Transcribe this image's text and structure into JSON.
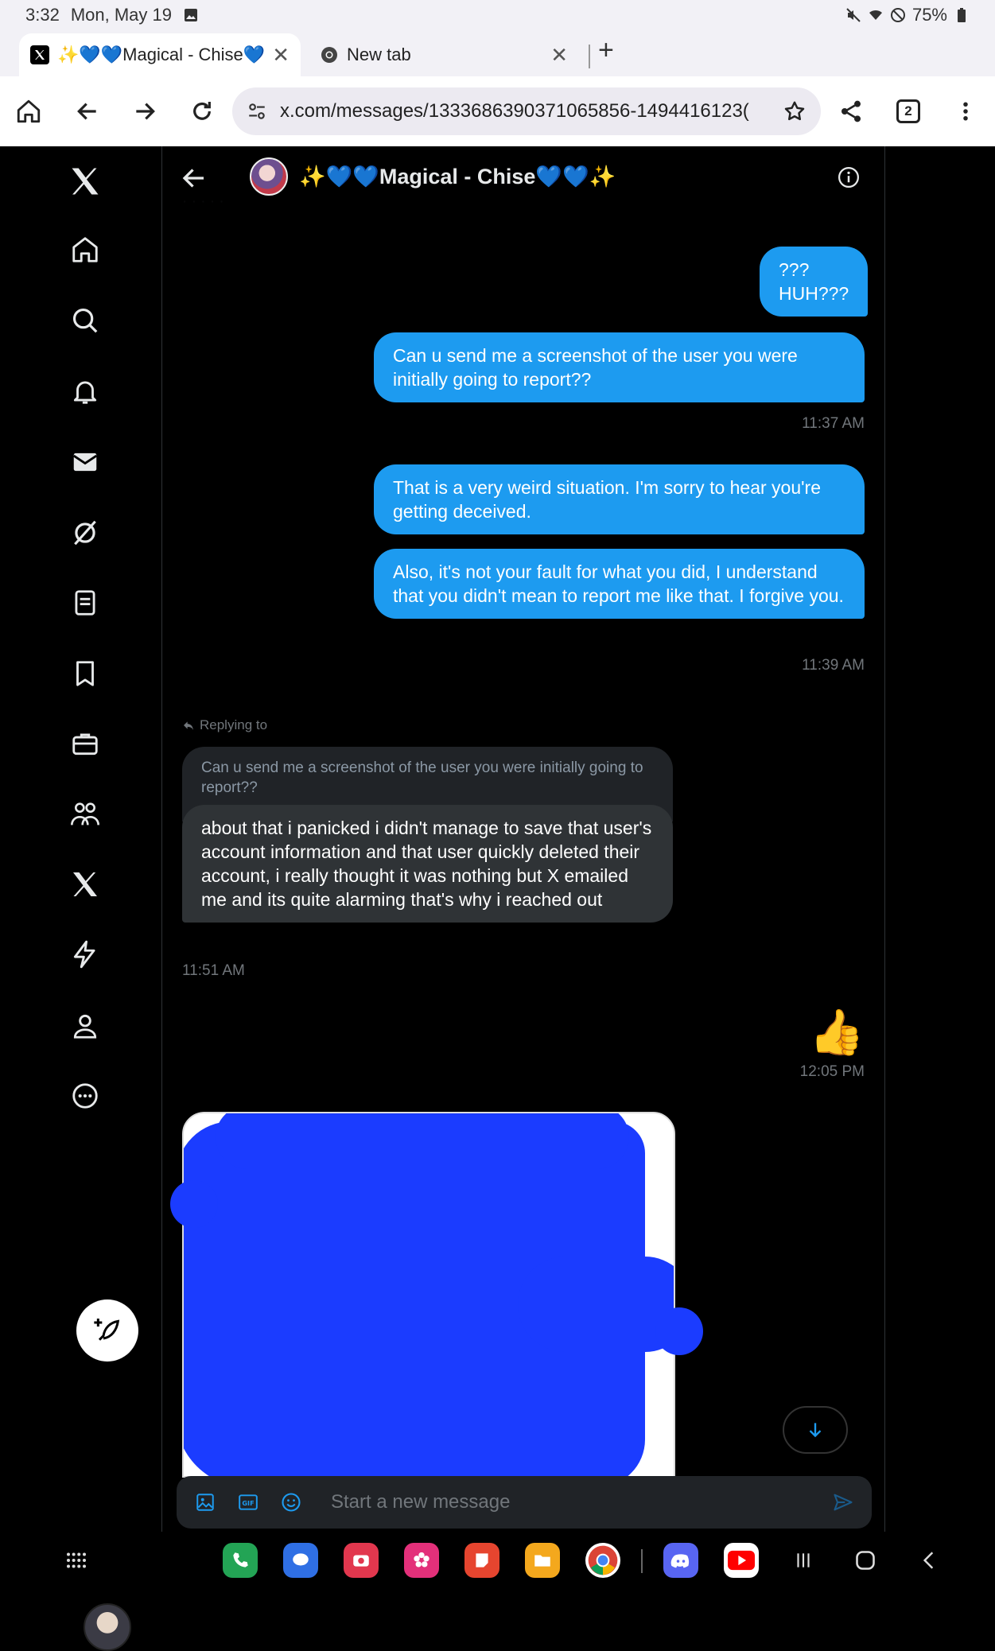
{
  "status_bar": {
    "time": "3:32",
    "date": "Mon, May 19",
    "battery": "75%"
  },
  "tabs": [
    {
      "title": "✨💙💙Magical - Chise💙💙",
      "active": true,
      "favicon": "x-logo-icon"
    },
    {
      "title": "New tab",
      "active": false,
      "favicon": "chrome-icon"
    }
  ],
  "toolbar": {
    "url": "x.com/messages/1333686390371065856-1494416123(",
    "tab_count": "2"
  },
  "conversation": {
    "name": "✨💙💙Magical - Chise💙💙✨",
    "messages": [
      {
        "text": "???\nHUH???",
        "direction": "out"
      },
      {
        "text": "Can u send me a screenshot of the user you were initially going to report??",
        "direction": "out"
      },
      {
        "time": "11:37 AM"
      },
      {
        "text": "That is a very weird situation. I'm sorry to hear you're getting deceived.",
        "direction": "out"
      },
      {
        "text": "Also, it's not your fault for what you did, I understand that you didn't mean to report me like that. I forgive you.",
        "direction": "out"
      },
      {
        "time": "11:39 AM"
      },
      {
        "replying_label": "Replying to"
      },
      {
        "quoted": "Can u send me a screenshot of the user you were initially going to report??"
      },
      {
        "text": "about that i panicked i didn't manage to save that user's account information and that user quickly deleted their account, i really thought it was nothing but X emailed me and its quite alarming that's why i reached out",
        "direction": "in"
      },
      {
        "time": "11:51 AM"
      },
      {
        "text": "👍",
        "direction": "out"
      },
      {
        "time": "12:05 PM"
      }
    ]
  },
  "composer": {
    "placeholder": "Start a new message"
  },
  "colors": {
    "accent": "#1d9bf0",
    "background": "#000000",
    "incoming_bubble": "#2f3336",
    "redaction": "#1b3cff"
  }
}
